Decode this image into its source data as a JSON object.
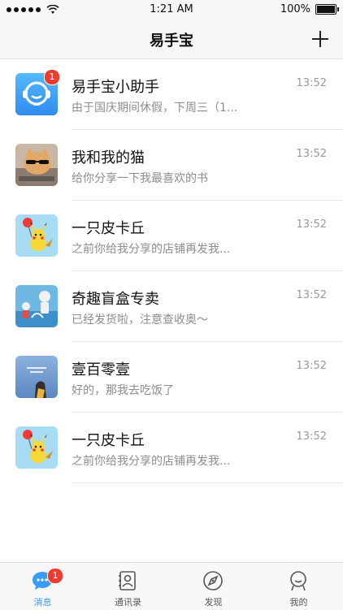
{
  "status": {
    "time": "1:21 AM",
    "battery": "100%"
  },
  "nav": {
    "title": "易手宝"
  },
  "conversations": [
    {
      "name": "易手宝小助手",
      "preview": "由于国庆期间休假，下周三（1...",
      "time": "13:52",
      "badge": "1"
    },
    {
      "name": "我和我的猫",
      "preview": "给你分享一下我最喜欢的书",
      "time": "13:52"
    },
    {
      "name": "一只皮卡丘",
      "preview": "之前你给我分享的店铺再发我...",
      "time": "13:52"
    },
    {
      "name": "奇趣盲盒专卖",
      "preview": "已经发货啦，注意查收奥～",
      "time": "13:52"
    },
    {
      "name": "壹百零壹",
      "preview": "好的，那我去吃饭了",
      "time": "13:52"
    },
    {
      "name": "一只皮卡丘",
      "preview": "之前你给我分享的店铺再发我...",
      "time": "13:52"
    }
  ],
  "tabs": [
    {
      "label": "消息",
      "icon": "chat-bubble-icon",
      "badge": "1"
    },
    {
      "label": "通讯录",
      "icon": "contacts-icon"
    },
    {
      "label": "发现",
      "icon": "compass-icon"
    },
    {
      "label": "我的",
      "icon": "profile-icon"
    }
  ],
  "colors": {
    "accent": "#3a9cf5",
    "badge": "#f23b30",
    "bar": "#f6f6f6"
  }
}
